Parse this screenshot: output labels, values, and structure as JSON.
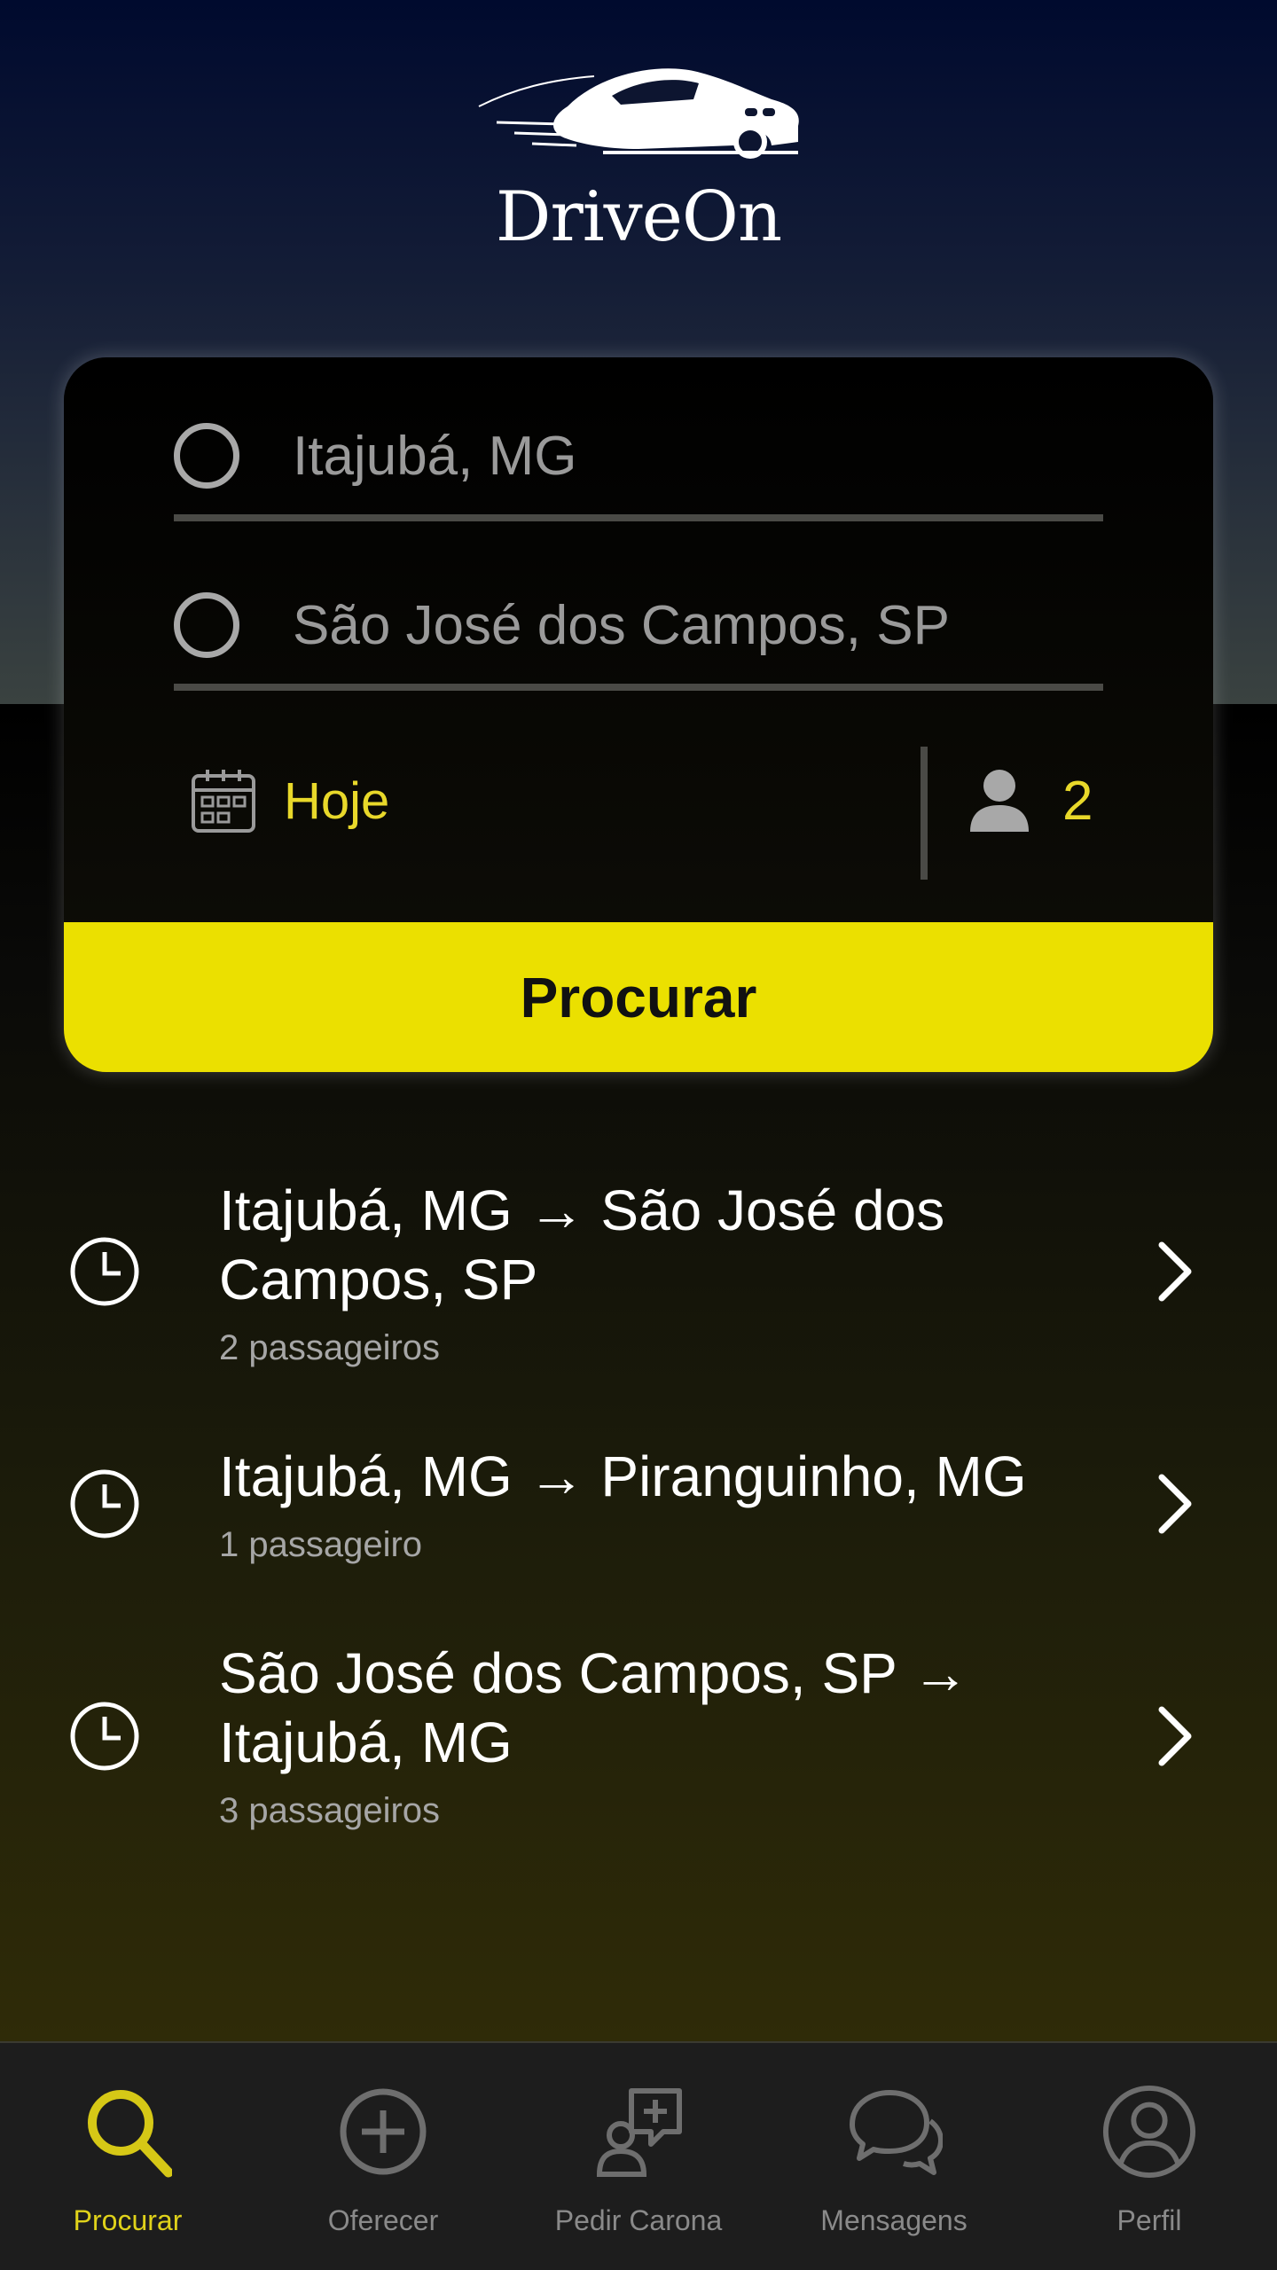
{
  "brand": {
    "name": "DriveOn"
  },
  "search": {
    "origin": "Itajubá, MG",
    "destination": "São José dos Campos, SP",
    "date": "Hoje",
    "passengers": "2",
    "button_label": "Procurar"
  },
  "history": [
    {
      "route_line1": "Itajubá, MG → São José dos",
      "route_line2": "Campos, SP",
      "passengers": "2 passageiros"
    },
    {
      "route_line1": "Itajubá, MG → Piranguinho, MG",
      "route_line2": "",
      "passengers": "1 passageiro"
    },
    {
      "route_line1": "São José dos Campos, SP →",
      "route_line2": "Itajubá, MG",
      "passengers": "3 passageiros"
    }
  ],
  "tabs": [
    {
      "label": "Procurar",
      "icon": "search-icon",
      "active": true
    },
    {
      "label": "Oferecer",
      "icon": "plus-circle-icon",
      "active": false
    },
    {
      "label": "Pedir Carona",
      "icon": "person-add-message-icon",
      "active": false
    },
    {
      "label": "Mensagens",
      "icon": "chat-bubbles-icon",
      "active": false
    },
    {
      "label": "Perfil",
      "icon": "user-circle-icon",
      "active": false
    }
  ],
  "colors": {
    "accent": "#ebe000",
    "accent_text": "#e8d82a",
    "tab_inactive": "#8a8a8a",
    "tab_active": "#e0d21a"
  }
}
